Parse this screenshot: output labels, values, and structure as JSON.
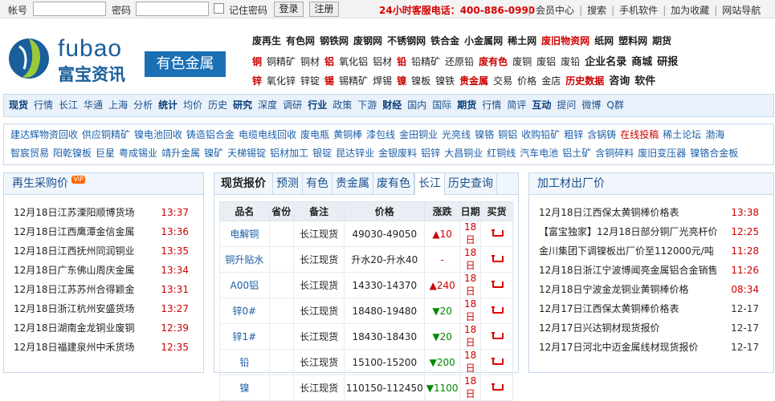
{
  "topbar": {
    "account_label": "帐号",
    "password_label": "密码",
    "remember_label": "记住密码",
    "login_btn": "登录",
    "register_btn": "注册",
    "hotline": "24小时客服电话：400-886-0990",
    "links": [
      "会员中心",
      "搜索",
      "手机软件",
      "加为收藏",
      "网站导航"
    ]
  },
  "brand": {
    "en": "fubao",
    "cn": "富宝资讯",
    "channel": "有色金属"
  },
  "header_nav": {
    "row1": [
      {
        "t": "废再生",
        "s": "b"
      },
      {
        "t": "有色网",
        "s": "b"
      },
      {
        "t": "钢铁网",
        "s": "b"
      },
      {
        "t": "废钢网",
        "s": "b"
      },
      {
        "t": "不锈钢网",
        "s": "b"
      },
      {
        "t": "铁合金",
        "s": "b"
      },
      {
        "t": "小金属网",
        "s": "b"
      },
      {
        "t": "稀土网",
        "s": "b"
      },
      {
        "t": "废旧物资网",
        "s": "r"
      },
      {
        "t": "纸网",
        "s": "b"
      },
      {
        "t": "塑料网",
        "s": "b"
      },
      {
        "t": "期货",
        "s": "b"
      }
    ],
    "row2": [
      {
        "t": "铜",
        "s": "r"
      },
      {
        "t": "铜精矿",
        "s": ""
      },
      {
        "t": "铜材",
        "s": ""
      },
      {
        "t": "铝",
        "s": "r"
      },
      {
        "t": "氧化铝",
        "s": ""
      },
      {
        "t": "铝材",
        "s": ""
      },
      {
        "t": "铅",
        "s": "r"
      },
      {
        "t": "铅精矿",
        "s": ""
      },
      {
        "t": "还原铅",
        "s": ""
      },
      {
        "t": "废有色",
        "s": "r"
      },
      {
        "t": "废铜",
        "s": ""
      },
      {
        "t": "废铝",
        "s": ""
      },
      {
        "t": "废铅",
        "s": ""
      },
      {
        "t": "企业名录",
        "s": "big"
      },
      {
        "t": "商城",
        "s": "big"
      },
      {
        "t": "研报",
        "s": "big"
      }
    ],
    "row3": [
      {
        "t": "锌",
        "s": "r"
      },
      {
        "t": "氧化锌",
        "s": ""
      },
      {
        "t": "锌锭",
        "s": ""
      },
      {
        "t": "锡",
        "s": "r"
      },
      {
        "t": "锡精矿",
        "s": ""
      },
      {
        "t": "焊锡",
        "s": ""
      },
      {
        "t": "镍",
        "s": "r"
      },
      {
        "t": "镍板",
        "s": ""
      },
      {
        "t": "镍铁",
        "s": ""
      },
      {
        "t": "贵金属",
        "s": "r"
      },
      {
        "t": "交易",
        "s": ""
      },
      {
        "t": "价格",
        "s": ""
      },
      {
        "t": "金店",
        "s": ""
      },
      {
        "t": "历史数据",
        "s": "r"
      },
      {
        "t": "咨询",
        "s": "big"
      },
      {
        "t": "软件",
        "s": "big"
      }
    ]
  },
  "main_nav": [
    {
      "t": "现货",
      "b": true
    },
    {
      "t": "行情",
      "b": false
    },
    {
      "t": "长江",
      "b": false
    },
    {
      "t": "华通",
      "b": false
    },
    {
      "t": "上海",
      "b": false
    },
    {
      "t": "分析",
      "b": false
    },
    {
      "t": "统计",
      "b": true
    },
    {
      "t": "均价",
      "b": false
    },
    {
      "t": "历史",
      "b": false
    },
    {
      "t": "研究",
      "b": true
    },
    {
      "t": "深度",
      "b": false
    },
    {
      "t": "调研",
      "b": false
    },
    {
      "t": "行业",
      "b": true
    },
    {
      "t": "政策",
      "b": false
    },
    {
      "t": "下游",
      "b": false
    },
    {
      "t": "财经",
      "b": true
    },
    {
      "t": "国内",
      "b": false
    },
    {
      "t": "国际",
      "b": false
    },
    {
      "t": "期货",
      "b": true
    },
    {
      "t": "行情",
      "b": false
    },
    {
      "t": "简评",
      "b": false
    },
    {
      "t": "互动",
      "b": true
    },
    {
      "t": "提问",
      "b": false
    },
    {
      "t": "微博",
      "b": false
    },
    {
      "t": "Q群",
      "b": false
    }
  ],
  "tags_row1": [
    {
      "t": "建达辉物资回收",
      "r": false
    },
    {
      "t": "供应铜精矿",
      "r": false
    },
    {
      "t": "镍电池回收",
      "r": false
    },
    {
      "t": "铸造铝合金",
      "r": false
    },
    {
      "t": "电缆电线回收",
      "r": false
    },
    {
      "t": "废电瓶",
      "r": false
    },
    {
      "t": "黄铜棒",
      "r": false
    },
    {
      "t": "漆包线",
      "r": false
    },
    {
      "t": "金田铜业",
      "r": false
    },
    {
      "t": "光亮线",
      "r": false
    },
    {
      "t": "镍铬",
      "r": false
    },
    {
      "t": "铜铝",
      "r": false
    },
    {
      "t": "收购铅矿",
      "r": false
    },
    {
      "t": "粗锌",
      "r": false
    },
    {
      "t": "含锅铸",
      "r": false
    },
    {
      "t": "在线投稿",
      "r": true
    },
    {
      "t": "稀土论坛",
      "r": false
    },
    {
      "t": "渤海",
      "r": false
    }
  ],
  "tags_row2": [
    {
      "t": "智宸贸易",
      "r": false
    },
    {
      "t": "阳乾镍板",
      "r": false
    },
    {
      "t": "巨星",
      "r": false
    },
    {
      "t": "粤成锡业",
      "r": false
    },
    {
      "t": "靖升金属",
      "r": false
    },
    {
      "t": "镍矿",
      "r": false
    },
    {
      "t": "天梯锡锭",
      "r": false
    },
    {
      "t": "铝材加工",
      "r": false
    },
    {
      "t": "银锭",
      "r": false
    },
    {
      "t": "昆达锌业",
      "r": false
    },
    {
      "t": "金银废料",
      "r": false
    },
    {
      "t": "铝锌",
      "r": false
    },
    {
      "t": "大昌铜业",
      "r": false
    },
    {
      "t": "红铜线",
      "r": false
    },
    {
      "t": "汽车电池",
      "r": false
    },
    {
      "t": "铝土矿",
      "r": false
    },
    {
      "t": "含铜碎料",
      "r": false
    },
    {
      "t": "废旧变压器",
      "r": false
    },
    {
      "t": "镍铬合金板",
      "r": false
    }
  ],
  "left_panel": {
    "title": "再生采购价",
    "badge": "VIP",
    "items": [
      {
        "t": "12月18日江苏溧阳顺博货场",
        "time": "13:37"
      },
      {
        "t": "12月18日江西鹰潭金信金属",
        "time": "13:36"
      },
      {
        "t": "12月18日江西抚州同润铜业",
        "time": "13:35"
      },
      {
        "t": "12月18日广东佛山周庆金属",
        "time": "13:34"
      },
      {
        "t": "12月18日江苏苏州合得颖金",
        "time": "13:31"
      },
      {
        "t": "12月18日浙江杭州安盛货场",
        "time": "13:27"
      },
      {
        "t": "12月18日湖南金龙铜业废铜",
        "time": "12:39"
      },
      {
        "t": "12月18日福建泉州中禾货场",
        "time": "12:35"
      }
    ]
  },
  "mid_panel": {
    "tabs": [
      "现货报价",
      "预测",
      "有色",
      "贵金属",
      "废有色",
      "长江",
      "历史查询"
    ],
    "active_tab": 5,
    "headers": [
      "品名",
      "省份",
      "备注",
      "价格",
      "涨跌",
      "日期",
      "买货"
    ],
    "rows": [
      {
        "name": "电解铜",
        "prov": "",
        "note": "长江现货",
        "price": "49030-49050",
        "chg": "10",
        "dir": "up",
        "date": "18日"
      },
      {
        "name": "铜升贴水",
        "prov": "",
        "note": "长江现货",
        "price": "升水20-升水40",
        "chg": "-",
        "dir": "flat",
        "date": "18日"
      },
      {
        "name": "A00铝",
        "prov": "",
        "note": "长江现货",
        "price": "14330-14370",
        "chg": "240",
        "dir": "up",
        "date": "18日"
      },
      {
        "name": "锌0#",
        "prov": "",
        "note": "长江现货",
        "price": "18480-19480",
        "chg": "20",
        "dir": "down",
        "date": "18日"
      },
      {
        "name": "锌1#",
        "prov": "",
        "note": "长江现货",
        "price": "18430-18430",
        "chg": "20",
        "dir": "down",
        "date": "18日"
      },
      {
        "name": "铅",
        "prov": "",
        "note": "长江现货",
        "price": "15100-15200",
        "chg": "200",
        "dir": "down",
        "date": "18日"
      },
      {
        "name": "镍",
        "prov": "",
        "note": "长江现货",
        "price": "110150-112450",
        "chg": "1100",
        "dir": "down",
        "date": "18日"
      }
    ]
  },
  "right_panel": {
    "title": "加工材出厂价",
    "items": [
      {
        "t": "12月18日江西保太黄铜棒价格表",
        "time": "13:38",
        "red": true
      },
      {
        "t": "【富宝独家】12月18日部分铜厂光亮杆价",
        "time": "12:25",
        "red": true
      },
      {
        "t": "金川集团下调镍板出厂价至112000元/吨",
        "time": "11:28",
        "red": true
      },
      {
        "t": "12月18日浙江宁波博闻亮金属铝合金销售",
        "time": "11:26",
        "red": true
      },
      {
        "t": "12月18日宁波金龙铜业黄铜棒价格",
        "time": "08:34",
        "red": true
      },
      {
        "t": "12月17日江西保太黄铜棒价格表",
        "time": "12-17",
        "red": false
      },
      {
        "t": "12月17日兴达铜材现货报价",
        "time": "12-17",
        "red": false
      },
      {
        "t": "12月17日河北中迈金属线材现货报价",
        "time": "12-17",
        "red": false
      }
    ]
  },
  "colors": {
    "brand_blue": "#1a6fb5",
    "accent_red": "#d60000",
    "up_red": "#cc0000",
    "down_green": "#008800"
  }
}
